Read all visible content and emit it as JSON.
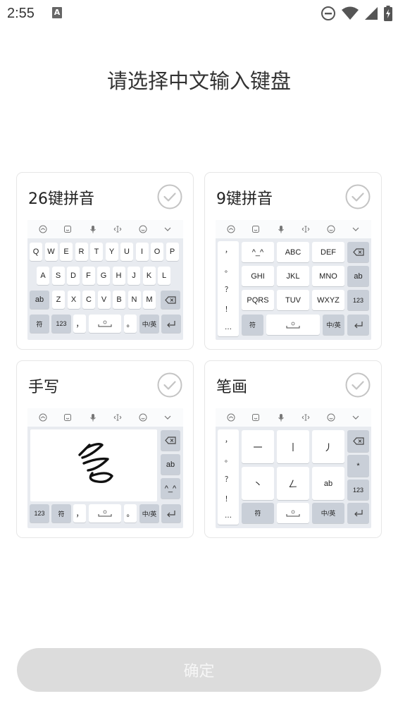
{
  "status_bar": {
    "time": "2:55",
    "notification_icon": "A"
  },
  "page": {
    "title": "请选择中文输入键盘",
    "confirm_label": "确定"
  },
  "cards": [
    {
      "id": "pinyin26",
      "label": "26键拼音"
    },
    {
      "id": "pinyin9",
      "label": "9键拼音"
    },
    {
      "id": "handwrite",
      "label": "手写"
    },
    {
      "id": "stroke",
      "label": "笔画"
    }
  ],
  "kb26": {
    "row1": [
      "Q",
      "W",
      "E",
      "R",
      "T",
      "Y",
      "U",
      "I",
      "O",
      "P"
    ],
    "row2": [
      "A",
      "S",
      "D",
      "F",
      "G",
      "H",
      "J",
      "K",
      "L"
    ],
    "row3": [
      "ab",
      "Z",
      "X",
      "C",
      "V",
      "B",
      "N",
      "M"
    ],
    "row4": [
      "符",
      "123",
      "，",
      "。",
      "中/英"
    ]
  },
  "kb9": {
    "punct": [
      "，",
      "。",
      "？",
      "！"
    ],
    "ellipsis": "…",
    "keys": [
      "^_^",
      "ABC",
      "DEF",
      "GHI",
      "JKL",
      "MNO",
      "PQRS",
      "TUV",
      "WXYZ"
    ],
    "side": [
      "ab",
      "123"
    ],
    "bottom": [
      "符",
      "中/英"
    ]
  },
  "kbhw": {
    "side": [
      "ab",
      "^_^"
    ],
    "bottom": [
      "123",
      "符",
      "，",
      "。",
      "中/英"
    ]
  },
  "kbstroke": {
    "punct": [
      "，",
      "。",
      "？",
      "！"
    ],
    "ellipsis": "…",
    "keys": [
      "一",
      "丨",
      "丿",
      "丶",
      "𠃋",
      "ab"
    ],
    "side": [
      "*",
      "123"
    ],
    "bottom": [
      "符",
      "中/英"
    ]
  },
  "colors": {
    "accent_gray": "#dcdcdc",
    "card_border": "#e6e6e6",
    "kb_bg": "#e8ebf0",
    "fn_key": "#c9cfd8"
  }
}
